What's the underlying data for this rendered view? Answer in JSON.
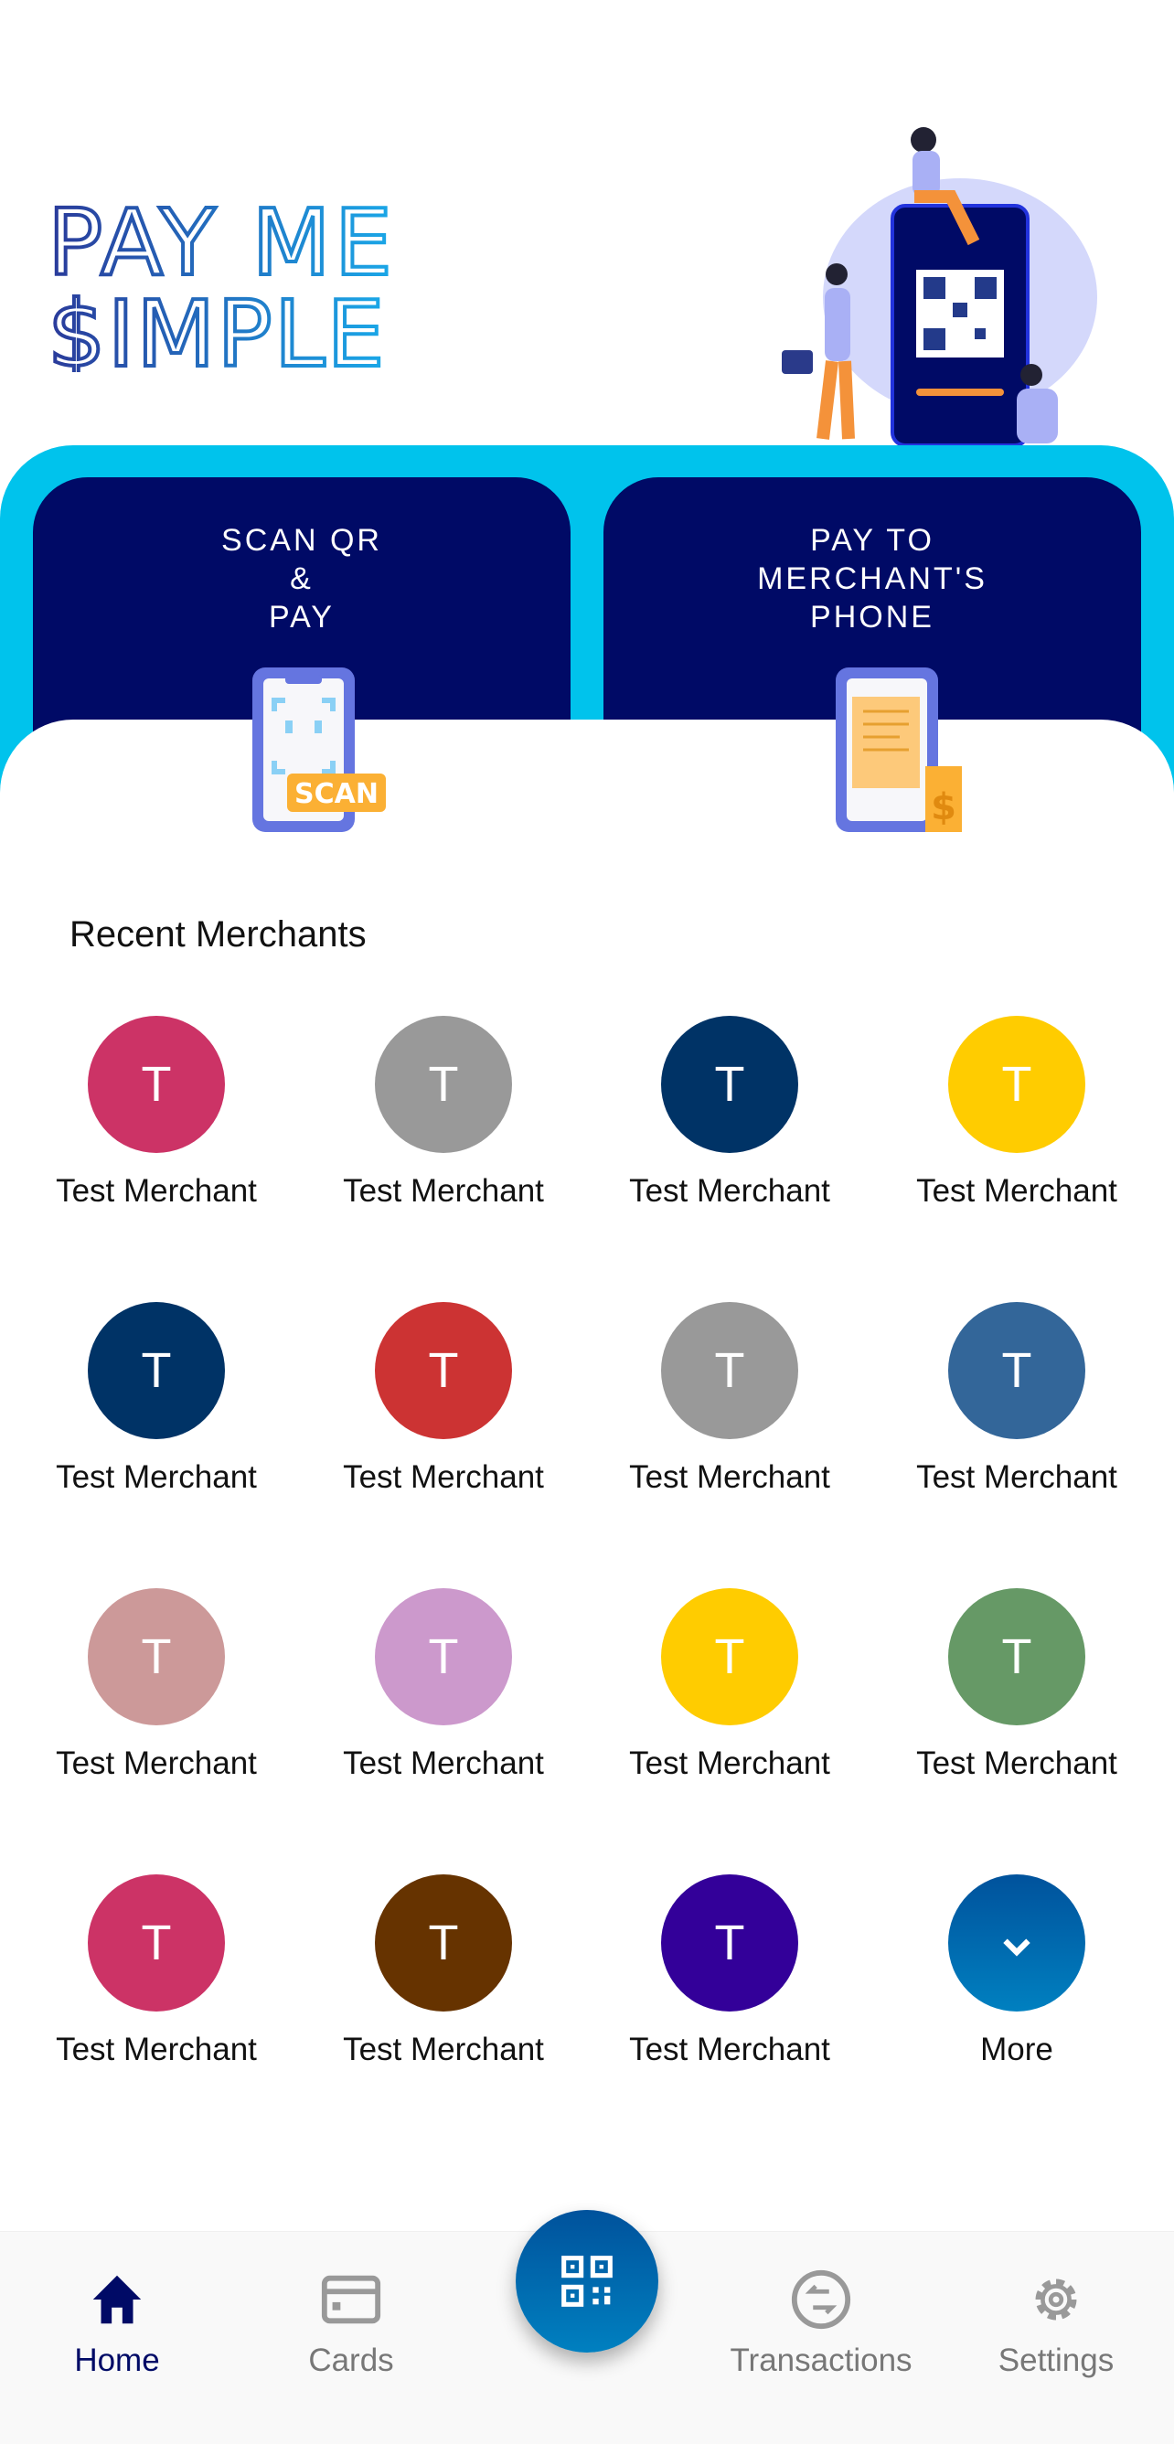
{
  "logo_text": "PAY ME $IMPLE",
  "actions": [
    {
      "lines": [
        "SCAN QR",
        "&",
        "PAY"
      ],
      "icon": "scan-qr-phone-icon"
    },
    {
      "lines": [
        "PAY TO",
        "MERCHANT'S",
        "PHONE"
      ],
      "icon": "receipt-phone-icon"
    }
  ],
  "recent_title": "Recent Merchants",
  "merchants": [
    {
      "initial": "T",
      "name": "Test Merchant",
      "color": "#cc3366"
    },
    {
      "initial": "T",
      "name": "Test Merchant",
      "color": "#999999"
    },
    {
      "initial": "T",
      "name": "Test Merchant",
      "color": "#003366"
    },
    {
      "initial": "T",
      "name": "Test Merchant",
      "color": "#ffcc00"
    },
    {
      "initial": "T",
      "name": "Test Merchant",
      "color": "#003366"
    },
    {
      "initial": "T",
      "name": "Test Merchant",
      "color": "#cc3333"
    },
    {
      "initial": "T",
      "name": "Test Merchant",
      "color": "#999999"
    },
    {
      "initial": "T",
      "name": "Test Merchant",
      "color": "#336699"
    },
    {
      "initial": "T",
      "name": "Test Merchant",
      "color": "#cc9999"
    },
    {
      "initial": "T",
      "name": "Test Merchant",
      "color": "#cc99cc"
    },
    {
      "initial": "T",
      "name": "Test Merchant",
      "color": "#ffcc00"
    },
    {
      "initial": "T",
      "name": "Test Merchant",
      "color": "#669966"
    },
    {
      "initial": "T",
      "name": "Test Merchant",
      "color": "#cc3366"
    },
    {
      "initial": "T",
      "name": "Test Merchant",
      "color": "#663300"
    },
    {
      "initial": "T",
      "name": "Test Merchant",
      "color": "#330099"
    }
  ],
  "more_label": "More",
  "nav": {
    "home": "Home",
    "cards": "Cards",
    "transactions": "Transactions",
    "settings": "Settings",
    "active": "home",
    "active_color": "#000a66"
  }
}
